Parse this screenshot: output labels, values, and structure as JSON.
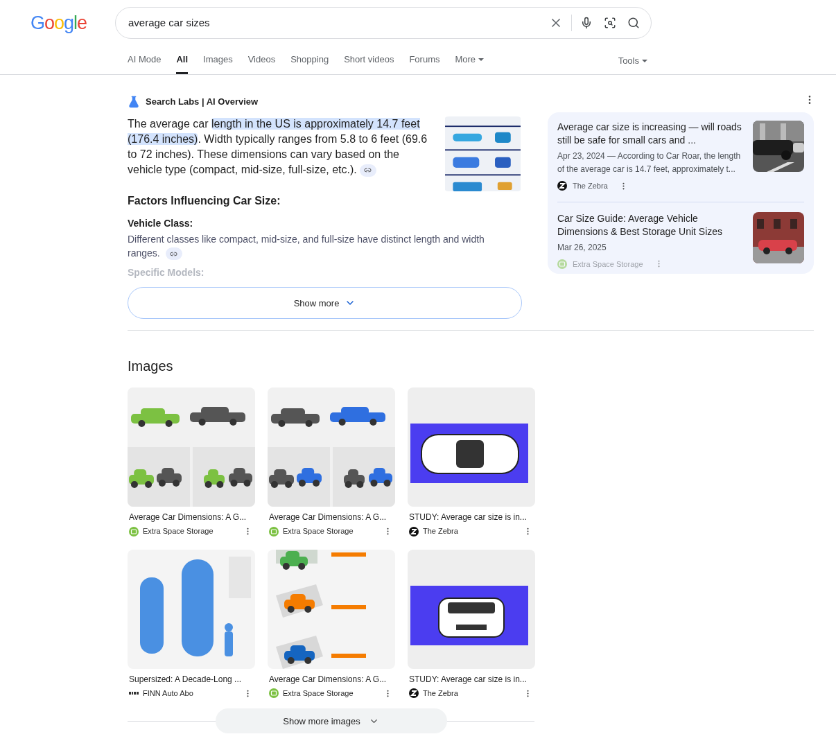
{
  "logo": "Google",
  "search": {
    "value": "average car sizes"
  },
  "tabs": [
    {
      "label": "AI Mode",
      "selected": false,
      "dropdown": false
    },
    {
      "label": "All",
      "selected": true,
      "dropdown": false
    },
    {
      "label": "Images",
      "selected": false,
      "dropdown": false
    },
    {
      "label": "Videos",
      "selected": false,
      "dropdown": false
    },
    {
      "label": "Shopping",
      "selected": false,
      "dropdown": false
    },
    {
      "label": "Short videos",
      "selected": false,
      "dropdown": false
    },
    {
      "label": "Forums",
      "selected": false,
      "dropdown": false
    },
    {
      "label": "More",
      "selected": false,
      "dropdown": true
    }
  ],
  "tools": {
    "label": "Tools"
  },
  "ai_overview": {
    "header": "Search Labs | AI Overview",
    "summary": [
      {
        "text": "The average car ",
        "highlighted": false
      },
      {
        "text": "length in the US is approximately 14.7 feet (176.4 inches)",
        "highlighted": true
      },
      {
        "text": ". Width typically ranges from 5.8 to 6 feet (69.6 to 72 inches). These dimensions can vary based on the vehicle type (compact, mid-size, full-size, etc.).",
        "highlighted": false
      }
    ],
    "heading": "Factors Influencing Car Size:",
    "sections": [
      {
        "heading": "Vehicle Class:",
        "body": "Different classes like compact, mid-size, and full-size have distinct length and width ranges.",
        "faded": false
      },
      {
        "heading": "Specific Models:",
        "faded": true
      }
    ],
    "show_more": "Show more",
    "sources": [
      {
        "title": "Average car size is increasing — will roads still be safe for small cars and ...",
        "date": "Apr 23, 2024",
        "snippet": "— According to Car Roar, the length of the average car is 14.7 feet, approximately t...",
        "source": {
          "name": "The Zebra",
          "kind": "zebra"
        },
        "faded": false
      },
      {
        "title": "Car Size Guide: Average Vehicle Dimensions & Best Storage Unit Sizes",
        "date": "Mar 26, 2025",
        "source": {
          "name": "Extra Space Storage",
          "kind": "ess"
        },
        "faded": true
      }
    ]
  },
  "images": {
    "heading": "Images",
    "items": [
      {
        "title": "Average Car Dimensions: A G...",
        "source": {
          "name": "Extra Space Storage",
          "kind": "ess"
        }
      },
      {
        "title": "Average Car Dimensions: A G...",
        "source": {
          "name": "Extra Space Storage",
          "kind": "ess"
        }
      },
      {
        "title": "STUDY: Average car size is in...",
        "source": {
          "name": "The Zebra",
          "kind": "zebra"
        }
      },
      {
        "title": "Supersized: A Decade-Long ...",
        "source": {
          "name": "FINN Auto Abo",
          "kind": "finn"
        }
      },
      {
        "title": "Average Car Dimensions: A G...",
        "source": {
          "name": "Extra Space Storage",
          "kind": "ess"
        }
      },
      {
        "title": "STUDY: Average car size is in...",
        "source": {
          "name": "The Zebra",
          "kind": "zebra"
        }
      }
    ],
    "show_more": "Show more images"
  }
}
